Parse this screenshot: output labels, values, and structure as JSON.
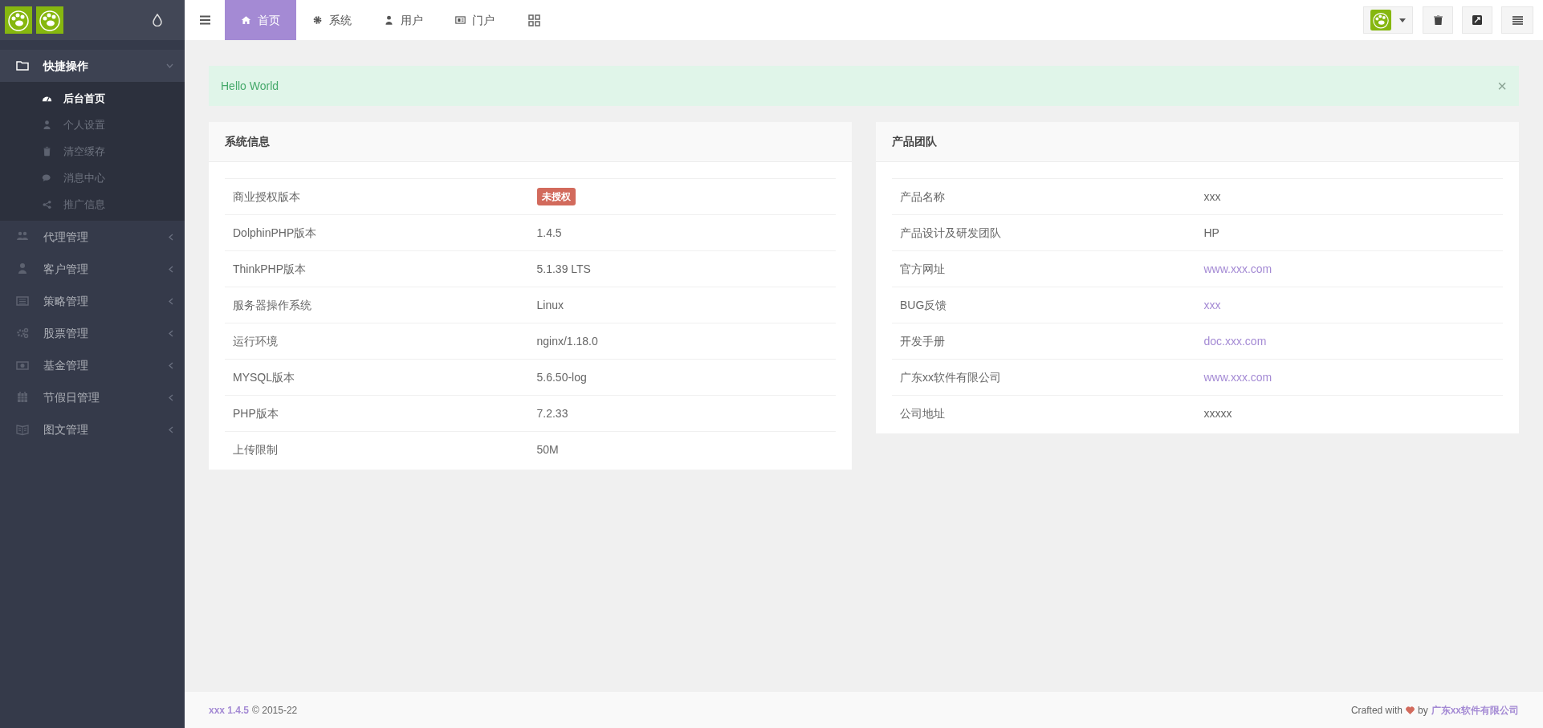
{
  "sidebar": {
    "items": [
      {
        "label": "快捷操作",
        "expanded": true,
        "children": [
          {
            "label": "后台首页",
            "selected": true
          },
          {
            "label": "个人设置",
            "selected": false
          },
          {
            "label": "清空缓存",
            "selected": false
          },
          {
            "label": "消息中心",
            "selected": false
          },
          {
            "label": "推广信息",
            "selected": false
          }
        ]
      },
      {
        "label": "代理管理",
        "expanded": false
      },
      {
        "label": "客户管理",
        "expanded": false
      },
      {
        "label": "策略管理",
        "expanded": false
      },
      {
        "label": "股票管理",
        "expanded": false
      },
      {
        "label": "基金管理",
        "expanded": false
      },
      {
        "label": "节假日管理",
        "expanded": false
      },
      {
        "label": "图文管理",
        "expanded": false
      }
    ]
  },
  "top_tabs": [
    {
      "label": "首页",
      "selected": true
    },
    {
      "label": "系统",
      "selected": false
    },
    {
      "label": "用户",
      "selected": false
    },
    {
      "label": "门户",
      "selected": false
    }
  ],
  "alert": {
    "text": "Hello World",
    "close": "×"
  },
  "cards": [
    {
      "title": "系统信息",
      "rows": [
        {
          "label": "商业授权版本",
          "value": "未授权",
          "kind": "badge"
        },
        {
          "label": "DolphinPHP版本",
          "value": "1.4.5",
          "kind": "text"
        },
        {
          "label": "ThinkPHP版本",
          "value": "5.1.39 LTS",
          "kind": "text"
        },
        {
          "label": "服务器操作系统",
          "value": "Linux",
          "kind": "text"
        },
        {
          "label": "运行环境",
          "value": "nginx/1.18.0",
          "kind": "text"
        },
        {
          "label": "MYSQL版本",
          "value": "5.6.50-log",
          "kind": "text"
        },
        {
          "label": "PHP版本",
          "value": "7.2.33",
          "kind": "text"
        },
        {
          "label": "上传限制",
          "value": "50M",
          "kind": "text"
        }
      ]
    },
    {
      "title": "产品团队",
      "rows": [
        {
          "label": "产品名称",
          "value": "xxx",
          "kind": "text"
        },
        {
          "label": "产品设计及研发团队",
          "value": "HP",
          "kind": "text"
        },
        {
          "label": "官方网址",
          "value": "www.xxx.com",
          "kind": "link"
        },
        {
          "label": "BUG反馈",
          "value": "xxx",
          "kind": "link"
        },
        {
          "label": "开发手册",
          "value": "doc.xxx.com",
          "kind": "link"
        },
        {
          "label": "广东xx软件有限公司",
          "value": "www.xxx.com",
          "kind": "link"
        },
        {
          "label": "公司地址",
          "value": "xxxxx",
          "kind": "text"
        }
      ]
    }
  ],
  "footer": {
    "product": "xxx 1.4.5",
    "copyright": "© 2015-22",
    "crafted": "Crafted with",
    "by": "by",
    "company": "广东xx软件有限公司"
  }
}
